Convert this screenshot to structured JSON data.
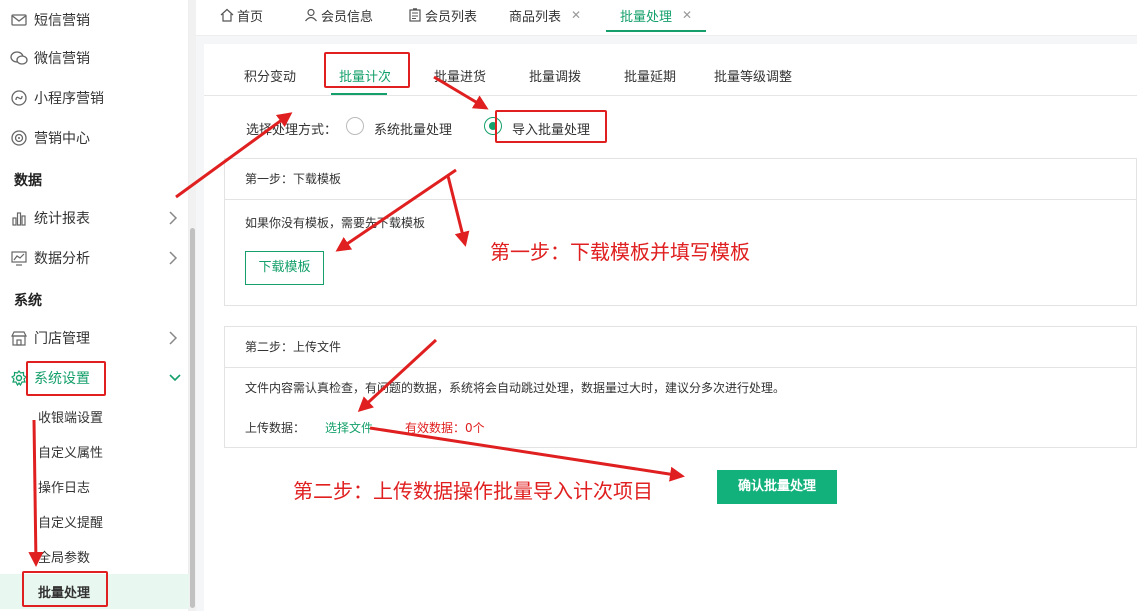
{
  "sidebar": {
    "items": [
      {
        "label": "短信营销",
        "icon": "mail-icon"
      },
      {
        "label": "微信营销",
        "icon": "wechat-icon"
      },
      {
        "label": "小程序营销",
        "icon": "miniprogram-icon"
      },
      {
        "label": "营销中心",
        "icon": "target-icon"
      }
    ],
    "section_data": "数据",
    "data_items": [
      {
        "label": "统计报表",
        "icon": "bar-chart-icon"
      },
      {
        "label": "数据分析",
        "icon": "line-chart-icon"
      }
    ],
    "section_system": "系统",
    "system_items": [
      {
        "label": "门店管理",
        "icon": "store-icon"
      },
      {
        "label": "系统设置",
        "icon": "gear-icon"
      }
    ],
    "sub_items": [
      "收银端设置",
      "自定义属性",
      "操作日志",
      "自定义提醒",
      "全局参数",
      "批量处理"
    ]
  },
  "topbar": {
    "tabs": [
      {
        "label": "首页",
        "icon": "home-icon"
      },
      {
        "label": "会员信息",
        "icon": "user-icon"
      },
      {
        "label": "会员列表",
        "icon": "list-icon"
      },
      {
        "label": "商品列表"
      },
      {
        "label": "批量处理"
      }
    ],
    "close_glyph": "✕"
  },
  "subtabs": [
    "积分变动",
    "批量计次",
    "批量进货",
    "批量调拨",
    "批量延期",
    "批量等级调整"
  ],
  "mode": {
    "label": "选择处理方式：",
    "options": [
      "系统批量处理",
      "导入批量处理"
    ],
    "selected": 1
  },
  "step1": {
    "title": "第一步：下载模板",
    "desc": "如果你没有模板，需要先下载模板",
    "button": "下载模板"
  },
  "step2": {
    "title": "第二步：上传文件",
    "desc": "文件内容需认真检查，有问题的数据，系统将会自动跳过处理，数据量过大时，建议分多次进行处理。",
    "upload_label": "上传数据：",
    "choose_file": "选择文件",
    "valid_count": "有效数据：0个"
  },
  "confirm_button": "确认批量处理",
  "annotations": {
    "note1": "第一步：下载模板并填写模板",
    "note2": "第二步：上传数据操作批量导入计次项目"
  },
  "colors": {
    "accent": "#15a06b",
    "annotation": "#e02020"
  }
}
